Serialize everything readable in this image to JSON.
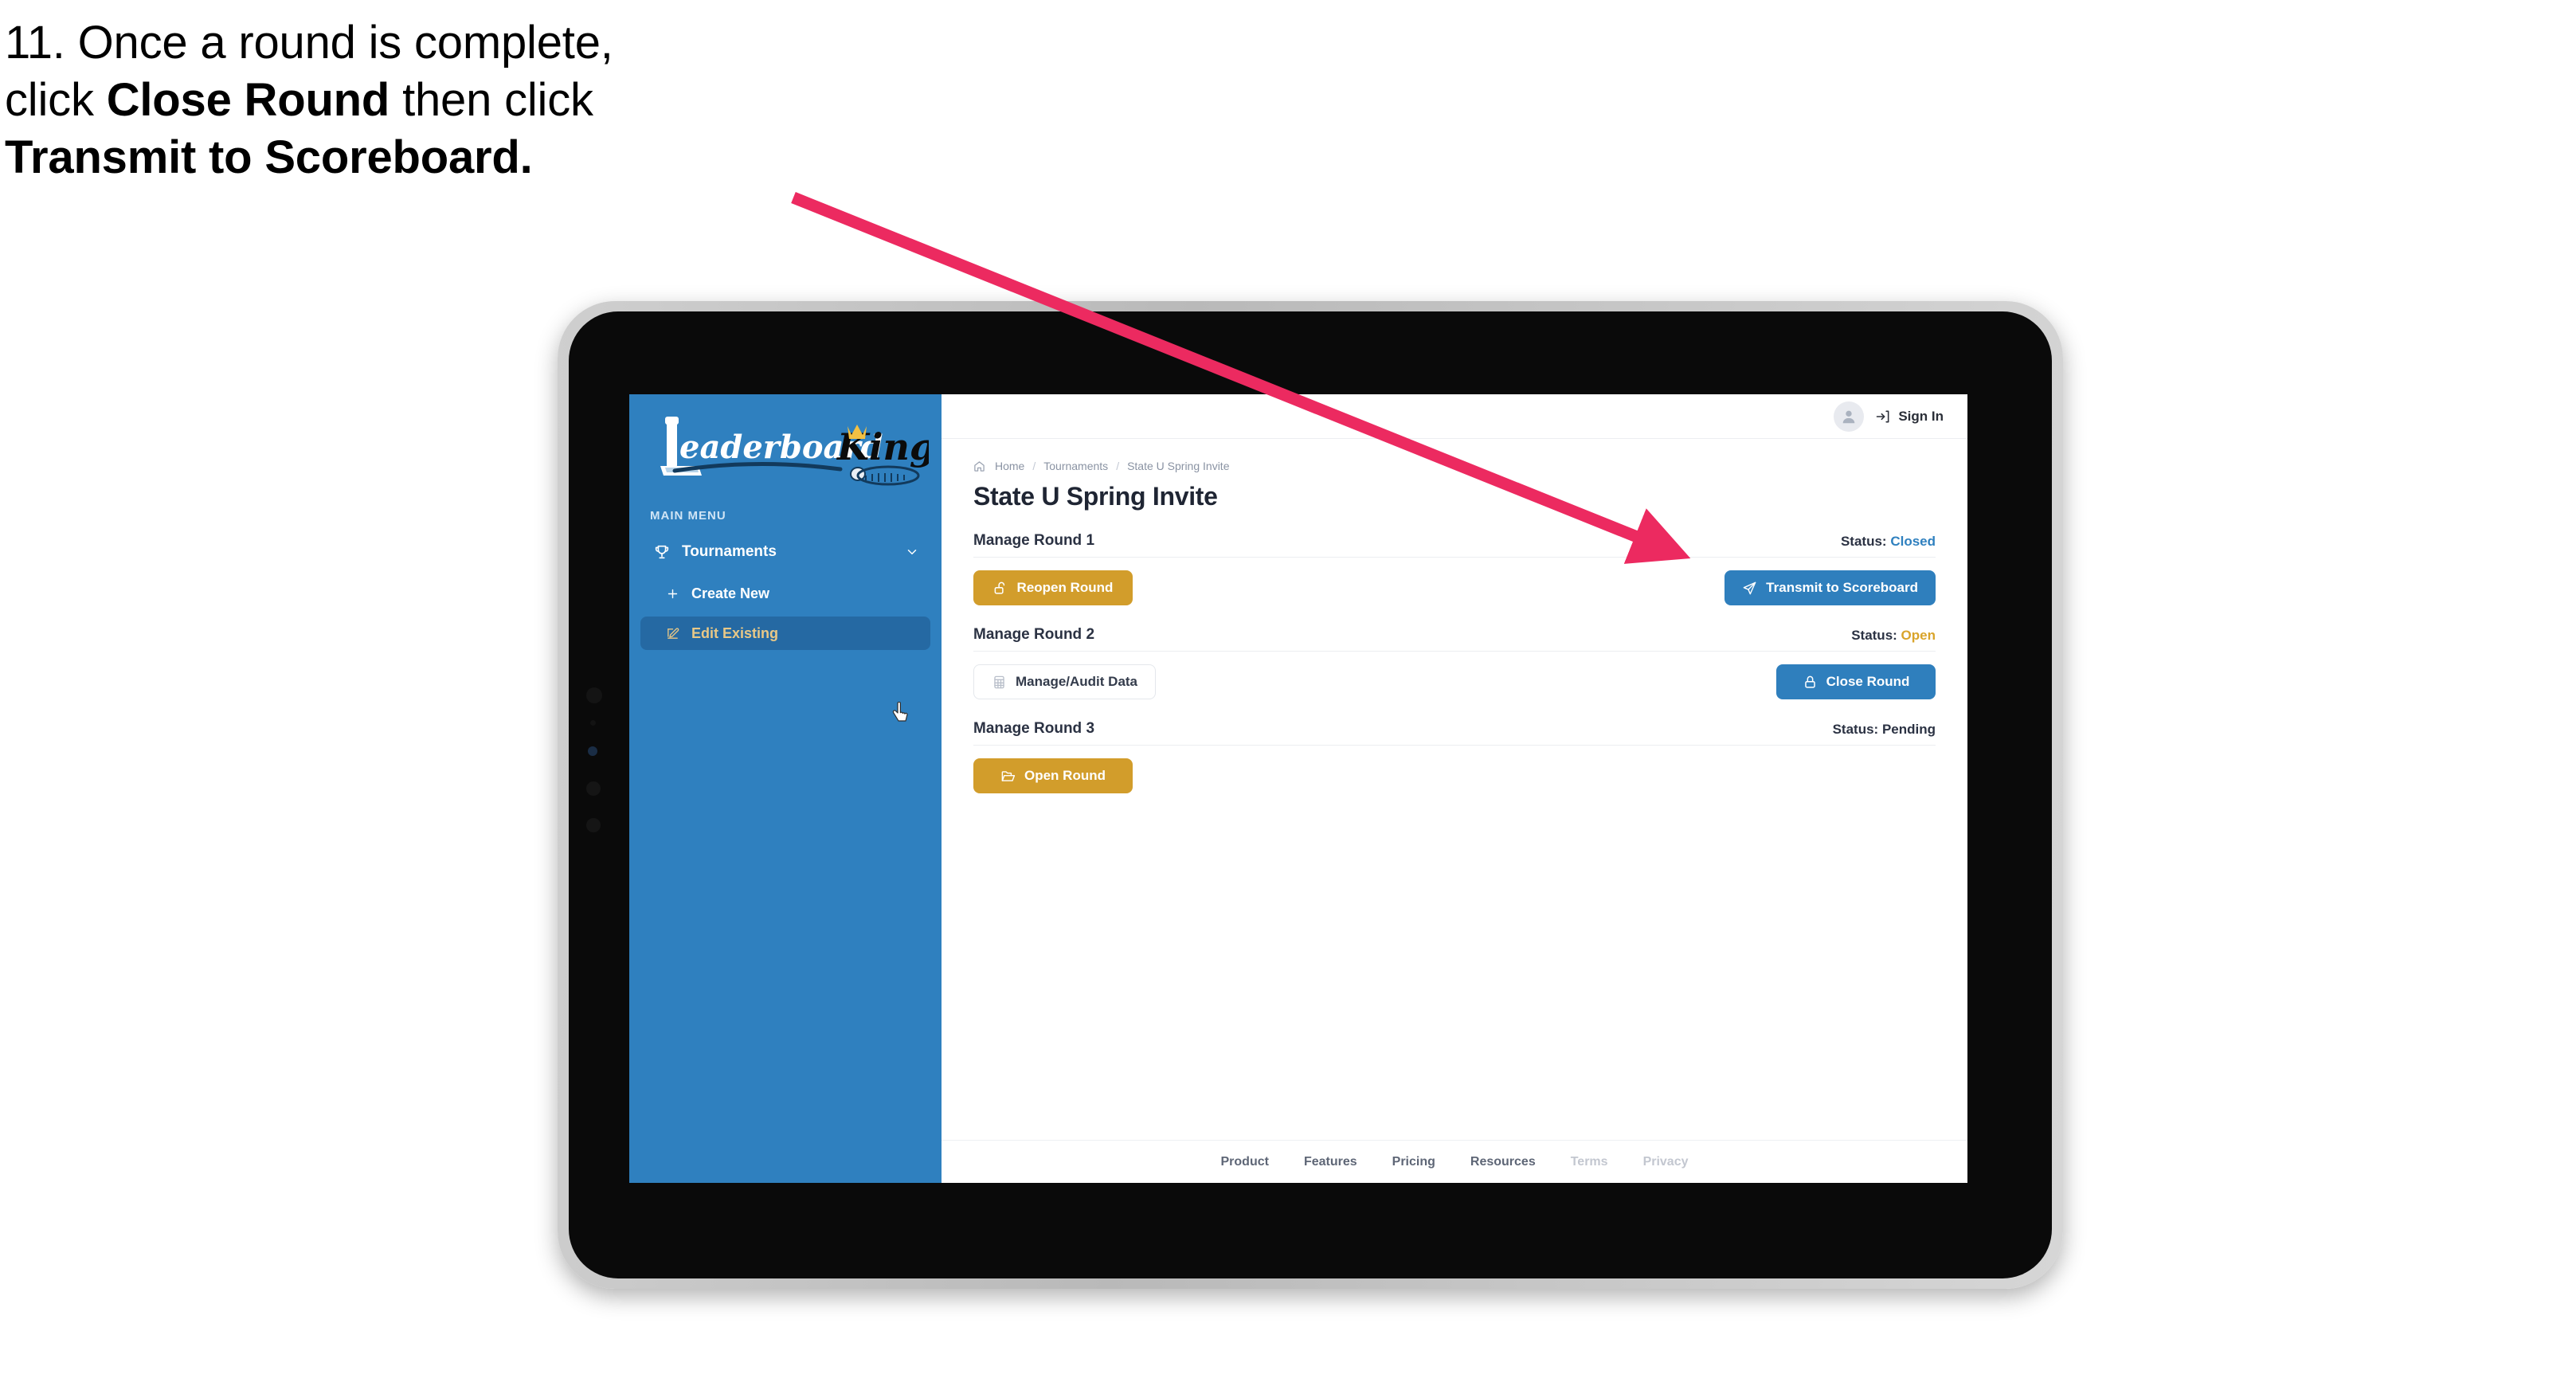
{
  "caption": {
    "line1": "11. Once a round is complete,",
    "line2_pre": "click ",
    "line2_bold": "Close Round",
    "line2_post": " then click",
    "line3_bold": "Transmit to Scoreboard."
  },
  "annotation": {
    "arrow_color": "#ec2a60"
  },
  "app": {
    "sidebar": {
      "logo_primary": "Leaderboard",
      "logo_secondary": "King",
      "section_label": "MAIN MENU",
      "items": [
        {
          "label": "Tournaments",
          "icon": "trophy-icon",
          "expanded": true
        },
        {
          "label": "Create New",
          "icon": "plus-icon",
          "active": false
        },
        {
          "label": "Edit Existing",
          "icon": "edit-square-icon",
          "active": true
        }
      ],
      "bg_color": "#2f80bf",
      "active_bg_color": "#2569a3",
      "active_text_color": "#e8c887"
    },
    "topbar": {
      "avatar_icon": "user-icon",
      "signin_icon": "sign-in-arrow-icon",
      "signin_label": "Sign In"
    },
    "breadcrumb": {
      "home_icon": "home-icon",
      "items": [
        "Home",
        "Tournaments",
        "State U Spring Invite"
      ],
      "separator": "/"
    },
    "page_title": "State U Spring Invite",
    "rounds": [
      {
        "title": "Manage Round 1",
        "status_label": "Status:",
        "status_value": "Closed",
        "status_tone": "closed",
        "left_button": {
          "label": "Reopen Round",
          "icon": "unlock-icon",
          "style": "gold"
        },
        "right_button": {
          "label": "Transmit to Scoreboard",
          "icon": "send-plane-icon",
          "style": "blue"
        }
      },
      {
        "title": "Manage Round 2",
        "status_label": "Status:",
        "status_value": "Open",
        "status_tone": "open",
        "left_button": {
          "label": "Manage/Audit Data",
          "icon": "table-grid-icon",
          "style": "ghost"
        },
        "right_button": {
          "label": "Close Round",
          "icon": "lock-icon",
          "style": "blue"
        }
      },
      {
        "title": "Manage Round 3",
        "status_label": "Status:",
        "status_value": "Pending",
        "status_tone": "pending",
        "left_button": {
          "label": "Open Round",
          "icon": "open-folder-icon",
          "style": "gold"
        },
        "right_button": null
      }
    ],
    "footer": {
      "links": [
        "Product",
        "Features",
        "Pricing",
        "Resources"
      ],
      "muted_links": [
        "Terms",
        "Privacy"
      ]
    },
    "colors": {
      "brand_blue": "#2f80bf",
      "button_blue": "#2f7fbd",
      "gold": "#d29d2b",
      "status_open": "#d9a42a",
      "status_closed": "#2f80bf",
      "text_dark": "#2b3243"
    }
  }
}
